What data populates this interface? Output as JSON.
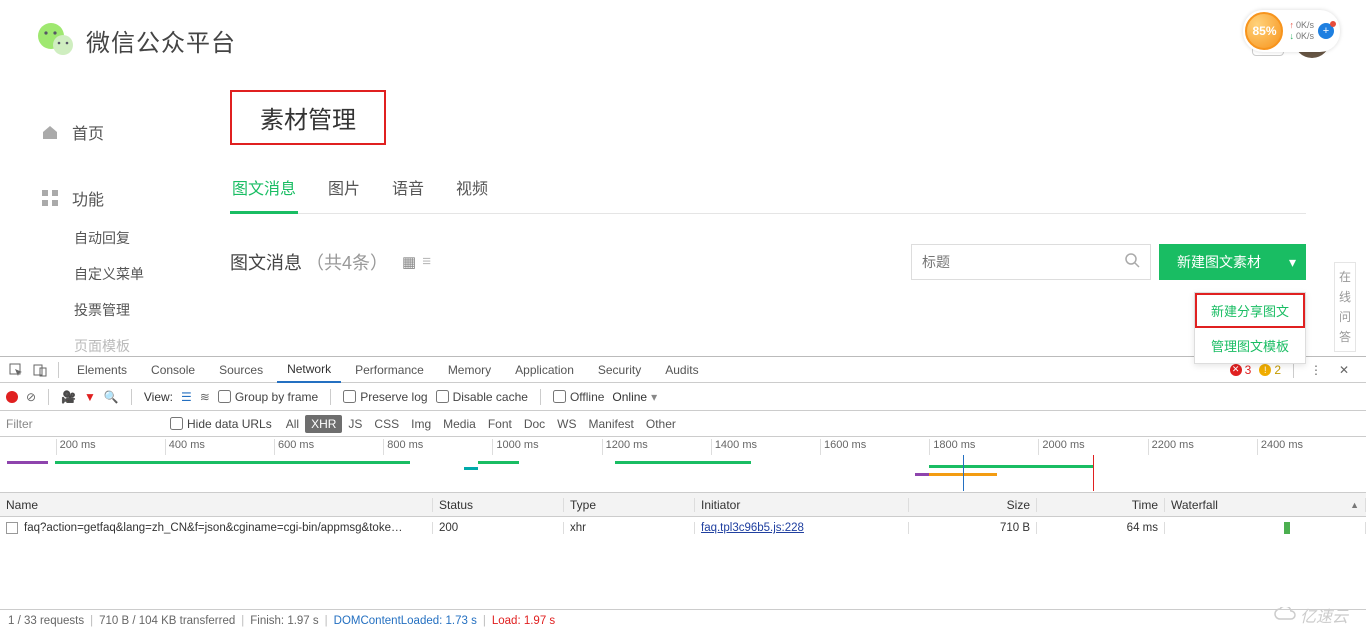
{
  "header": {
    "brand": "微信公众平台",
    "overlay": {
      "percent": "85%",
      "up": "0K/s",
      "down": "0K/s"
    }
  },
  "sidebar": {
    "home": "首页",
    "features": "功能",
    "sub": [
      "自动回复",
      "自定义菜单",
      "投票管理",
      "页面模板"
    ]
  },
  "main": {
    "page_title": "素材管理",
    "tabs": [
      "图文消息",
      "图片",
      "语音",
      "视频"
    ],
    "content": {
      "title": "图文消息",
      "count_label": "（共4条）",
      "search_placeholder": "标题",
      "new_btn": "新建图文素材",
      "dropdown": [
        "新建分享图文",
        "管理图文模板"
      ]
    },
    "float_help": [
      "在",
      "线",
      "问",
      "答"
    ]
  },
  "devtools": {
    "tabs": [
      "Elements",
      "Console",
      "Sources",
      "Network",
      "Performance",
      "Memory",
      "Application",
      "Security",
      "Audits"
    ],
    "active_tab": "Network",
    "errors": "3",
    "warnings": "2",
    "toolbar": {
      "view_label": "View:",
      "group": "Group by frame",
      "preserve": "Preserve log",
      "disable_cache": "Disable cache",
      "offline": "Offline",
      "throttle": "Online"
    },
    "filter": {
      "placeholder": "Filter",
      "hide_urls": "Hide data URLs",
      "types": [
        "All",
        "XHR",
        "JS",
        "CSS",
        "Img",
        "Media",
        "Font",
        "Doc",
        "WS",
        "Manifest",
        "Other"
      ],
      "active_type": "XHR"
    },
    "timeline_ticks": [
      "200 ms",
      "400 ms",
      "600 ms",
      "800 ms",
      "1000 ms",
      "1200 ms",
      "1400 ms",
      "1600 ms",
      "1800 ms",
      "2000 ms",
      "2200 ms",
      "2400 ms"
    ],
    "columns": [
      "Name",
      "Status",
      "Type",
      "Initiator",
      "Size",
      "Time",
      "Waterfall"
    ],
    "rows": [
      {
        "name": "faq?action=getfaq&lang=zh_CN&f=json&cginame=cgi-bin/appmsg&toke…",
        "status": "200",
        "type": "xhr",
        "initiator": "faq.tpl3c96b5.js:228",
        "size": "710 B",
        "time": "64 ms"
      }
    ],
    "status": {
      "requests": "1 / 33 requests",
      "transferred": "710 B / 104 KB transferred",
      "finish": "Finish: 1.97 s",
      "dcl": "DOMContentLoaded: 1.73 s",
      "load": "Load: 1.97 s"
    }
  },
  "watermark": "亿速云"
}
